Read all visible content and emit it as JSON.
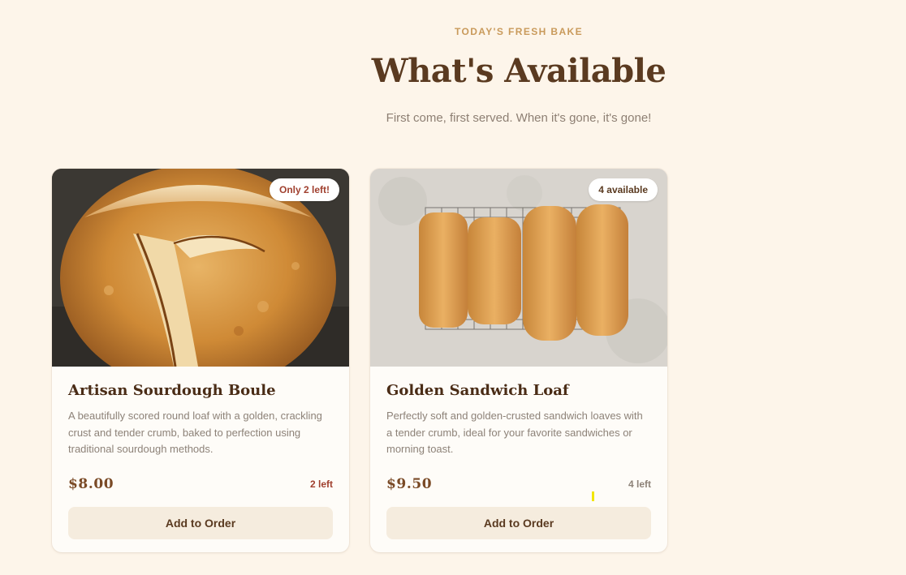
{
  "header": {
    "eyebrow": "TODAY'S FRESH BAKE",
    "title": "What's Available",
    "subtitle": "First come, first served. When it's gone, it's gone!"
  },
  "products": [
    {
      "name": "Artisan Sourdough Boule",
      "description": "A beautifully scored round loaf with a golden, crackling crust and tender crumb, baked to perfection using traditional sourdough methods.",
      "price": "$8.00",
      "stock_label": "2 left",
      "badge": "Only 2 left!",
      "button_label": "Add to Order"
    },
    {
      "name": "Golden Sandwich Loaf",
      "description": "Perfectly soft and golden-crusted sandwich loaves with a tender crumb, ideal for your favorite sandwiches or morning toast.",
      "price": "$9.50",
      "stock_label": "4 left",
      "badge": "4 available",
      "button_label": "Add to Order"
    }
  ],
  "colors": {
    "background": "#fdf5ea",
    "accent": "#c99a5b",
    "heading": "#5a3a20",
    "low_stock": "#a0402f",
    "button_bg": "#f5ecde"
  }
}
